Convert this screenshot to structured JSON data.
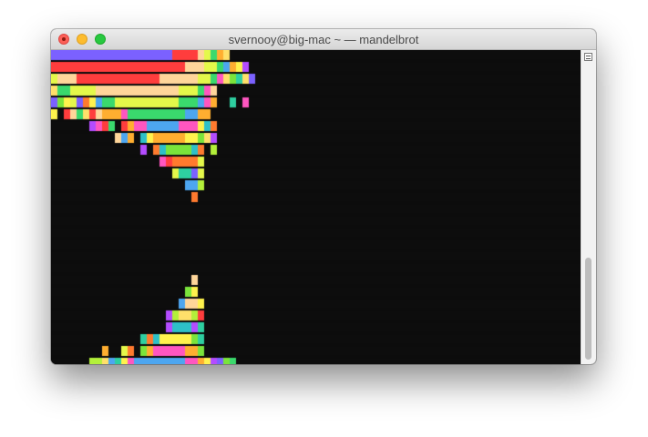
{
  "window": {
    "title": "svernooy@big-mac ~ — mandelbrot",
    "traffic_lights": {
      "close_color": "#fc5f57",
      "minimize_color": "#fdbc2e",
      "maximize_color": "#28c840"
    }
  },
  "terminal": {
    "content": "mandelbrot ascii render (colored block characters)",
    "background_color": "#0c0c0c",
    "palette": [
      "#ffd69a",
      "#ffe06a",
      "#fff24d",
      "#e4f84a",
      "#b3f03a",
      "#7ae43b",
      "#3ad96d",
      "#2ecfa0",
      "#2ec0c8",
      "#4da6f0",
      "#7b61ff",
      "#b44cff",
      "#ff56c0",
      "#ff3d3d",
      "#ff7a2e",
      "#ffae30"
    ]
  },
  "scrollbar": {
    "menu_icon": "list-icon",
    "scroll_position": 0.72
  }
}
